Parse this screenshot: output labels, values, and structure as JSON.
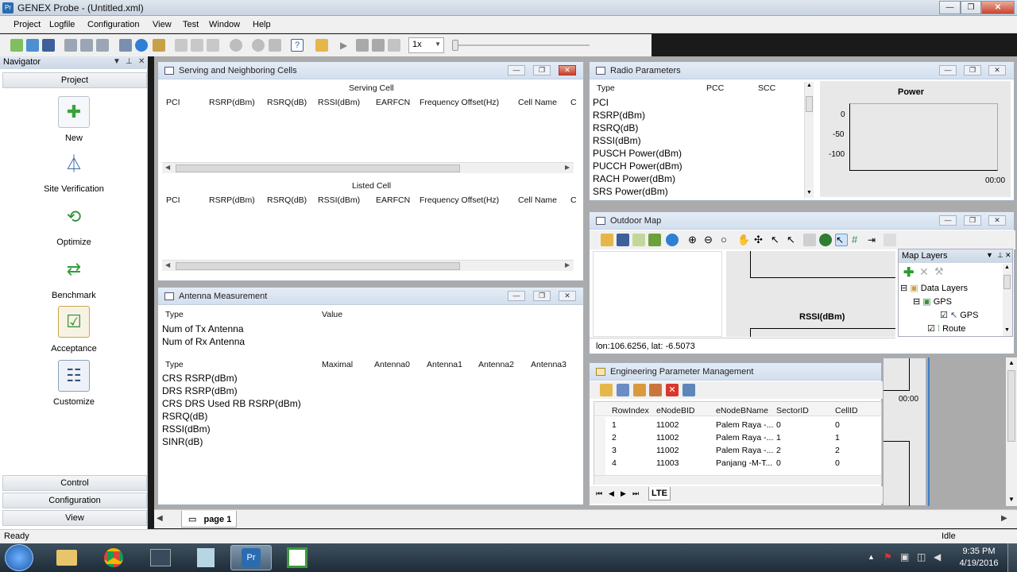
{
  "window": {
    "title": "GENEX Probe - (Untitled.xml)",
    "app_icon_text": "Pr"
  },
  "menu": [
    "Project",
    "Logfile",
    "Configuration",
    "View",
    "Test",
    "Window",
    "Help"
  ],
  "toolbar": {
    "playback_speed": "1x"
  },
  "navigator": {
    "title": "Navigator",
    "top_section": "Project",
    "items": [
      {
        "label": "New",
        "icon": "new-document-icon"
      },
      {
        "label": "Site Verification",
        "icon": "antenna-tower-icon"
      },
      {
        "label": "Optimize",
        "icon": "optimize-icon"
      },
      {
        "label": "Benchmark",
        "icon": "benchmark-arrows-icon"
      },
      {
        "label": "Acceptance",
        "icon": "acceptance-checklist-icon"
      },
      {
        "label": "Customize",
        "icon": "customize-icon"
      }
    ],
    "bottom_sections": [
      "Control",
      "Configuration",
      "View"
    ]
  },
  "serving_cells": {
    "title": "Serving and Neighboring Cells",
    "serving_title": "Serving Cell",
    "listed_title": "Listed Cell",
    "columns": [
      "PCI",
      "RSRP(dBm)",
      "RSRQ(dB)",
      "RSSI(dBm)",
      "EARFCN",
      "Frequency Offset(Hz)",
      "Cell Name",
      "C"
    ]
  },
  "antenna": {
    "title": "Antenna Measurement",
    "top_columns": [
      "Type",
      "Value"
    ],
    "top_rows": [
      "Num of Tx Antenna",
      "Num of Rx Antenna"
    ],
    "bottom_columns": [
      "Type",
      "Maximal",
      "Antenna0",
      "Antenna1",
      "Antenna2",
      "Antenna3"
    ],
    "bottom_rows": [
      "CRS RSRP(dBm)",
      "DRS RSRP(dBm)",
      "CRS DRS Used RB RSRP(dBm)",
      "RSRQ(dB)",
      "RSSI(dBm)",
      "SINR(dB)"
    ]
  },
  "radio": {
    "title": "Radio Parameters",
    "columns": [
      "Type",
      "PCC",
      "SCC"
    ],
    "rows": [
      "PCI",
      "RSRP(dBm)",
      "RSRQ(dB)",
      "RSSI(dBm)",
      "PUSCH Power(dBm)",
      "PUCCH Power(dBm)",
      "RACH Power(dBm)",
      "SRS Power(dBm)"
    ],
    "chart_title": "Power",
    "y_ticks": [
      "0",
      "-50",
      "-100"
    ],
    "x_tick": "00:00"
  },
  "outdoor_map": {
    "title": "Outdoor Map",
    "coords": "lon:106.6256, lat: -6.5073",
    "graph_title": "RSSI(dBm)",
    "layers_title": "Map Layers",
    "tree": [
      "Data Layers",
      "GPS",
      "GPS",
      "Route"
    ]
  },
  "eng_params": {
    "title": "Engineering Parameter Management",
    "columns": [
      "RowIndex",
      "eNodeBID",
      "eNodeBName",
      "SectorID",
      "CellID"
    ],
    "rows": [
      [
        "1",
        "11002",
        "Palem Raya -...",
        "0",
        "0"
      ],
      [
        "2",
        "11002",
        "Palem Raya -...",
        "1",
        "1"
      ],
      [
        "3",
        "11002",
        "Palem Raya -...",
        "2",
        "2"
      ],
      [
        "4",
        "11003",
        "Panjang -M-T...",
        "0",
        "0"
      ]
    ],
    "tab": "LTE",
    "side_time": "00:00"
  },
  "page_tab": "page 1",
  "status": {
    "left": "Ready",
    "right": "Idle"
  },
  "clock": {
    "time": "9:35 PM",
    "date": "4/19/2016"
  }
}
